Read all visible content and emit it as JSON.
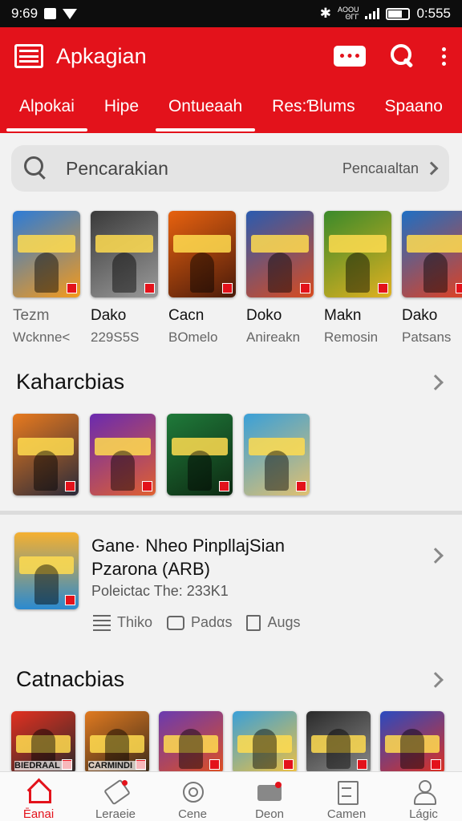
{
  "status_bar": {
    "time": "9:69",
    "network_top": "AOOU",
    "network_bottom": "ΘΓΓ",
    "battery": "0:555"
  },
  "header": {
    "title": "Apkagian",
    "tabs": [
      {
        "label": "Alpokai",
        "active": true
      },
      {
        "label": "Hipe",
        "active": false
      },
      {
        "label": "Ontueaah",
        "active": true
      },
      {
        "label": "Res:Ɓlums",
        "active": false
      },
      {
        "label": "Spaano",
        "active": false
      }
    ]
  },
  "search": {
    "placeholder": "Pencarakian",
    "right_label": "Pencaıaltan"
  },
  "top_games": [
    {
      "name": "Tezm",
      "sub": "Wcknne<",
      "thumb_text": "",
      "colors": [
        "#2b7bd8",
        "#f59a1a"
      ]
    },
    {
      "name": "Dako",
      "sub": "229S5S",
      "thumb_text": "",
      "colors": [
        "#3a3a3a",
        "#9a9a9a"
      ]
    },
    {
      "name": "Cacn",
      "sub": "BOmelo",
      "thumb_text": "",
      "colors": [
        "#e8620f",
        "#4a1a0a"
      ]
    },
    {
      "name": "Doko",
      "sub": "Anireakn",
      "thumb_text": "",
      "colors": [
        "#2a5bb0",
        "#d94b1f"
      ]
    },
    {
      "name": "Makn",
      "sub": "Remosin",
      "thumb_text": "",
      "colors": [
        "#3a8a2a",
        "#e0b020"
      ]
    },
    {
      "name": "Dako",
      "sub": "Patsans",
      "thumb_text": "",
      "colors": [
        "#1e6fc4",
        "#e24020"
      ]
    }
  ],
  "section_1": {
    "title": "Kaharcbias"
  },
  "section_1_items": [
    {
      "colors": [
        "#e87a1e",
        "#2a2a3a"
      ]
    },
    {
      "colors": [
        "#6a2ab0",
        "#e06030"
      ]
    },
    {
      "colors": [
        "#1f7a3a",
        "#0d2a12"
      ]
    },
    {
      "colors": [
        "#3aa0d8",
        "#e0c070"
      ]
    }
  ],
  "feature": {
    "title_line1": "Gane· Nheo PinpllajSian",
    "title_line2": "Pzarona (ARB)",
    "subtitle": "Poleictac The: 233K1",
    "actions": [
      {
        "label": "Thiko",
        "icon": "list-icon"
      },
      {
        "label": "Padαs",
        "icon": "chat-icon"
      },
      {
        "label": "Augs",
        "icon": "box-icon"
      }
    ],
    "colors": [
      "#f5b030",
      "#2a8ad0"
    ]
  },
  "section_2": {
    "title": "Catnacbias"
  },
  "section_2_items": [
    {
      "label": "BIEDRAAL",
      "colors": [
        "#e23020",
        "#2a2a2a"
      ]
    },
    {
      "label": "CARMINDI",
      "colors": [
        "#e07a20",
        "#3a2a1a"
      ]
    },
    {
      "label": "",
      "colors": [
        "#6a3ab0",
        "#e05020"
      ]
    },
    {
      "label": "",
      "colors": [
        "#3aa0d8",
        "#f0c040"
      ]
    },
    {
      "label": "",
      "colors": [
        "#2a2a2a",
        "#8a8a8a"
      ]
    },
    {
      "label": "",
      "colors": [
        "#2a4ac0",
        "#e03020"
      ]
    }
  ],
  "bottom_nav": [
    {
      "label": "Ēanai",
      "icon": "home-icon",
      "active": true
    },
    {
      "label": "Leraeie",
      "icon": "tag-icon",
      "active": false
    },
    {
      "label": "Cene",
      "icon": "target-icon",
      "active": false
    },
    {
      "label": "Deon",
      "icon": "tv-icon",
      "active": false
    },
    {
      "label": "Camen",
      "icon": "doc-icon",
      "active": false
    },
    {
      "label": "Lágic",
      "icon": "user-icon",
      "active": false
    }
  ],
  "colors": {
    "accent": "#e3121b",
    "background": "#f2f2f2"
  }
}
